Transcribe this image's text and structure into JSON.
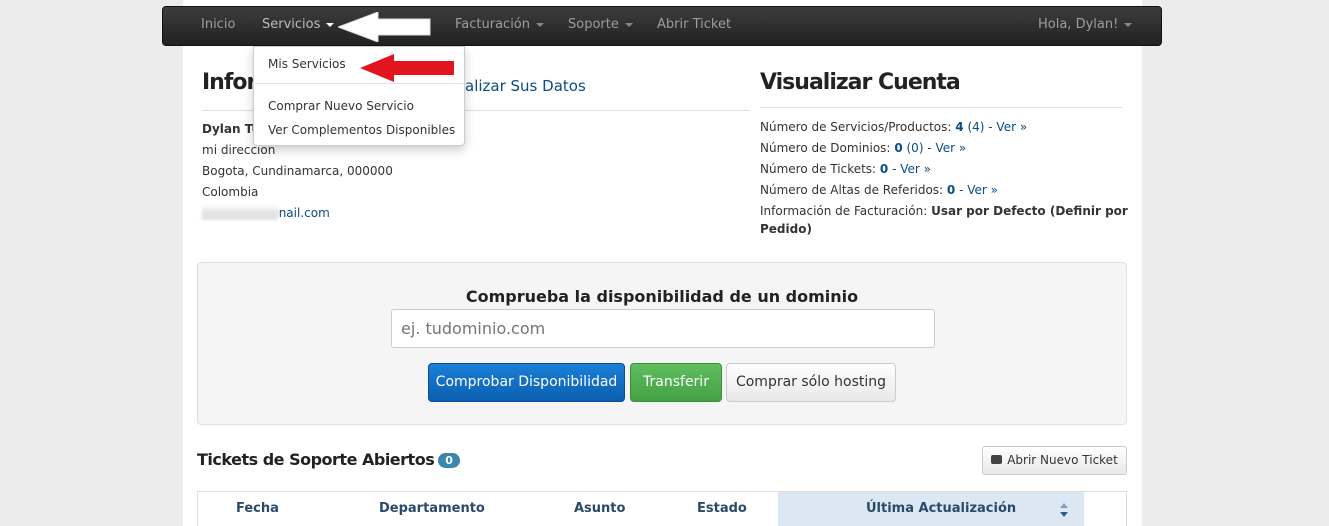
{
  "navbar": {
    "items": [
      {
        "label": "Inicio"
      },
      {
        "label": "Servicios"
      },
      {
        "label": "Facturación"
      },
      {
        "label": "Soporte"
      },
      {
        "label": "Abrir Ticket"
      }
    ],
    "user_menu": "Hola, Dylan!"
  },
  "dropdown": {
    "items": [
      {
        "label": "Mis Servicios"
      },
      {
        "label": "Comprar Nuevo Servicio"
      },
      {
        "label": "Ver Complementos Disponibles"
      }
    ]
  },
  "info": {
    "title_visible": "Infor",
    "update_link_visible": "alizar Sus Datos",
    "name_visible": "Dylan Tu",
    "address": "mi dirección",
    "city": "Bogota, Cundinamarca, 000000",
    "country": "Colombia",
    "email_visible": "nail.com"
  },
  "account": {
    "title": "Visualizar Cuenta",
    "services_label": "Número de Servicios/Productos:",
    "services_value": "4",
    "services_extra": "(4) - Ver »",
    "domains_label": "Número de Dominios:",
    "domains_value": "0",
    "domains_extra": "(0) - Ver »",
    "tickets_label": "Número de Tickets:",
    "tickets_value": "0",
    "tickets_extra": "- Ver »",
    "referrals_label": "Número de Altas de Referidos:",
    "referrals_value": "0",
    "referrals_extra": "- Ver »",
    "billing_label": "Información de Facturación:",
    "billing_value_1": "Usar por Defecto (Definir por",
    "billing_value_2": "Pedido)"
  },
  "domain_check": {
    "title": "Comprueba la disponibilidad de un dominio",
    "placeholder": "ej. tudominio.com",
    "check_button": "Comprobar Disponibilidad",
    "transfer_button": "Transferir",
    "hosting_button": "Comprar sólo hosting"
  },
  "tickets": {
    "title": "Tickets de Soporte Abiertos",
    "count": "0",
    "new_ticket_button": "Abrir Nuevo Ticket",
    "columns": [
      "Fecha",
      "Departamento",
      "Asunto",
      "Estado",
      "Última Actualización"
    ]
  },
  "colors": {
    "navbar": "#222222",
    "link": "#0a4d84",
    "primary": "#0b5fb0",
    "success": "#44a044",
    "badge": "#3a87ad",
    "arrow_red": "#e0151d"
  }
}
